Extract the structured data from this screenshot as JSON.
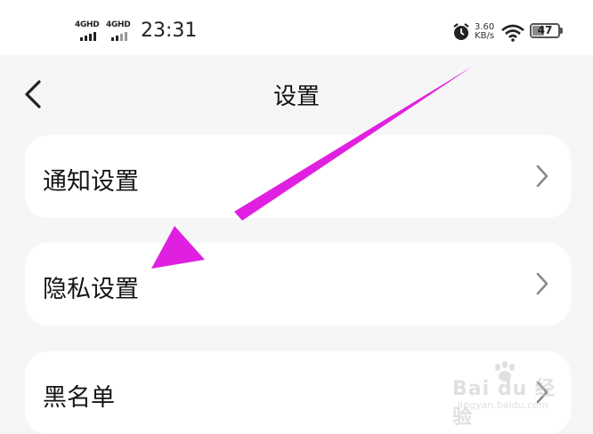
{
  "status_bar": {
    "signal_1": "4GHD",
    "signal_2": "4GHD",
    "time": "23:31",
    "net_speed_value": "3.60",
    "net_speed_unit": "KB/s",
    "battery_level": "47",
    "battery_fraction": 0.47
  },
  "header": {
    "title": "设置",
    "back_icon": "chevron-left-icon"
  },
  "menu": {
    "items": [
      {
        "label": "通知设置",
        "icon": "chevron-right-icon"
      },
      {
        "label": "隐私设置",
        "icon": "chevron-right-icon"
      },
      {
        "label": "黑名单",
        "icon": "chevron-right-icon"
      }
    ]
  },
  "annotation": {
    "arrow_color": "#e020e0"
  },
  "watermark": {
    "brand": "Bai du 经验",
    "url": "jingyan.baidu.com"
  }
}
